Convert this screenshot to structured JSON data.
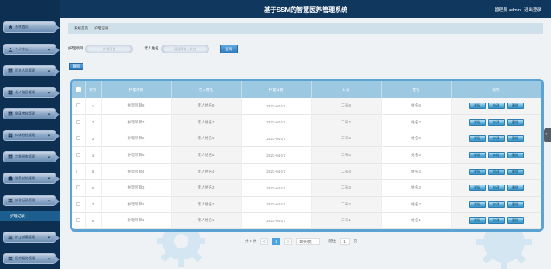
{
  "header": {
    "title": "基于SSM的智慧医养管理系统",
    "user_label": "管理员 admin",
    "logout_label": "退出登录"
  },
  "sidebar": {
    "items": [
      {
        "label": "系统首页",
        "icon": "home-icon"
      },
      {
        "label": "个人中心",
        "icon": "user-icon"
      },
      {
        "label": "医护人员管理",
        "icon": "grid-icon"
      },
      {
        "label": "老人信息管理",
        "icon": "grid-icon"
      },
      {
        "label": "健康考核管理",
        "icon": "grid-icon"
      },
      {
        "label": "体体检检管理",
        "icon": "grid-icon"
      },
      {
        "label": "定期巡查管理",
        "icon": "grid-icon"
      },
      {
        "label": "消费总结管理",
        "icon": "bag-icon"
      },
      {
        "label": "护理记录管理",
        "icon": "list-icon"
      },
      {
        "label": "护工派遣管理",
        "icon": "list-icon"
      },
      {
        "label": "医疗服务管理",
        "icon": "list-icon"
      }
    ],
    "active_sub": "护理记录"
  },
  "breadcrumb": {
    "home": "系统首页",
    "sep": ":",
    "current": "护理记录"
  },
  "search": {
    "field1_label": "护理项目",
    "field1_placeholder": "护理项目",
    "field2_label": "老人姓名",
    "field2_placeholder": "请选择老人姓名",
    "button": "查询"
  },
  "toolbar": {
    "delete_label": "删除"
  },
  "table": {
    "columns": [
      "索引",
      "护理项目",
      "老人姓名",
      "护理日期",
      "工号",
      "姓名",
      "操作"
    ],
    "rows": [
      {
        "index": "1",
        "project": "护理项目8",
        "elder": "老人姓名8",
        "date": "2023-04-17",
        "work_id": "工号8",
        "name": "姓名8"
      },
      {
        "index": "2",
        "project": "护理项目7",
        "elder": "老人姓名7",
        "date": "2023-04-17",
        "work_id": "工号7",
        "name": "姓名7"
      },
      {
        "index": "3",
        "project": "护理项目6",
        "elder": "老人姓名6",
        "date": "2023-04-17",
        "work_id": "工号6",
        "name": "姓名6"
      },
      {
        "index": "4",
        "project": "护理项目5",
        "elder": "老人姓名5",
        "date": "2023-04-17",
        "work_id": "工号5",
        "name": "姓名5"
      },
      {
        "index": "5",
        "project": "护理项目4",
        "elder": "老人姓名4",
        "date": "2023-04-17",
        "work_id": "工号4",
        "name": "姓名4"
      },
      {
        "index": "6",
        "project": "护理项目3",
        "elder": "老人姓名3",
        "date": "2023-04-17",
        "work_id": "工号3",
        "name": "姓名3"
      },
      {
        "index": "7",
        "project": "护理项目2",
        "elder": "老人姓名2",
        "date": "2023-04-17",
        "work_id": "工号2",
        "name": "姓名2"
      },
      {
        "index": "8",
        "project": "护理项目1",
        "elder": "老人姓名1",
        "date": "2023-04-17",
        "work_id": "工号1",
        "name": "姓名1"
      }
    ],
    "actions": [
      "详情",
      "修改",
      "删除"
    ]
  },
  "pagination": {
    "total": "共 8 条",
    "prev": "<",
    "current_page": "1",
    "next": ">",
    "page_size": "10条/页",
    "goto_label": "前往",
    "goto_value": "1",
    "page_unit": "页"
  },
  "colors": {
    "sidebar_bg": "#0c2f52",
    "header_bg": "#10375e",
    "accent": "#4aa3df",
    "table_border": "#5aa3d2"
  }
}
